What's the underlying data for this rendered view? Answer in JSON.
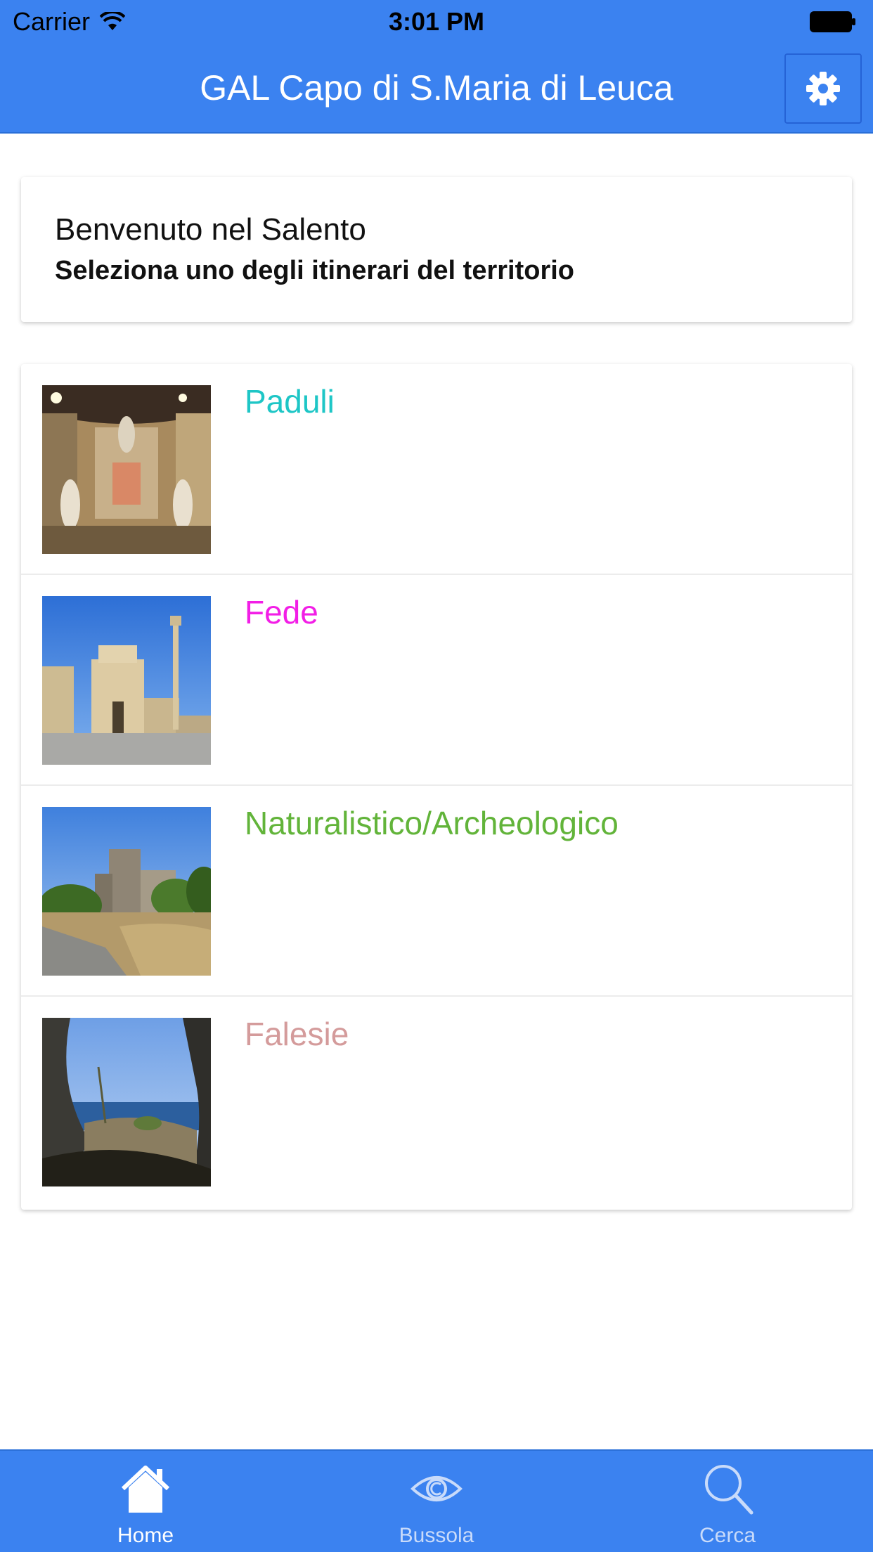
{
  "status_bar": {
    "carrier": "Carrier",
    "time": "3:01 PM"
  },
  "nav": {
    "title": "GAL Capo di S.Maria di Leuca",
    "settings_icon": "gear-icon"
  },
  "welcome": {
    "title": "Benvenuto nel Salento",
    "subtitle": "Seleziona uno degli itinerari del territorio"
  },
  "itineraries": [
    {
      "label": "Paduli",
      "color": "#1ec6c6",
      "thumb": "church-interior-photo"
    },
    {
      "label": "Fede",
      "color": "#f21ee6",
      "thumb": "basilica-square-photo"
    },
    {
      "label": "Naturalistico/Archeologico",
      "color": "#62b43a",
      "thumb": "tower-ruins-photo"
    },
    {
      "label": "Falesie",
      "color": "#d49b9b",
      "thumb": "sea-cliff-cave-photo"
    }
  ],
  "tabs": [
    {
      "label": "Home",
      "icon": "home-icon",
      "active": true
    },
    {
      "label": "Bussola",
      "icon": "eye-icon",
      "active": false
    },
    {
      "label": "Cerca",
      "icon": "search-icon",
      "active": false
    }
  ],
  "colors": {
    "primary": "#3b82f0",
    "tab_active": "#ffffff",
    "tab_inactive": "#c9dbfa"
  }
}
